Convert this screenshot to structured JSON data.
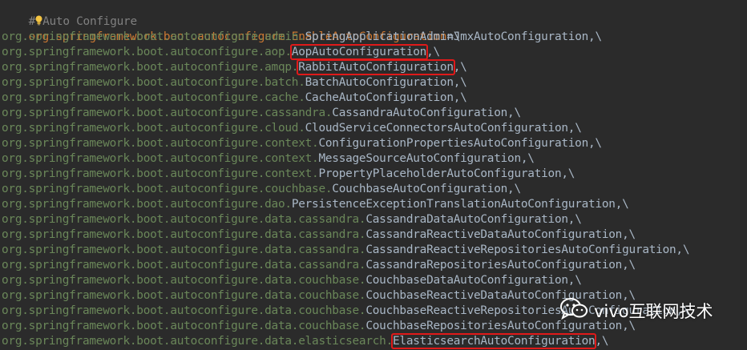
{
  "editor": {
    "header": {
      "hash": "#",
      "bulb_icon": "lightbulb-icon",
      "comment": "Auto Configure"
    },
    "first_line": {
      "key": "org.springframework.boot.autoconfigure.EnableAutoConfiguration",
      "suffix": "=\\"
    },
    "lines": [
      {
        "pkg": "org.springframework.boot.autoconfigure.admin.",
        "cls": "SpringApplicationAdminJmxAutoConfiguration",
        "tail": ",\\",
        "highlight": false
      },
      {
        "pkg": "org.springframework.boot.autoconfigure.aop.",
        "cls": "AopAutoConfiguration",
        "tail": ",\\",
        "highlight": true
      },
      {
        "pkg": "org.springframework.boot.autoconfigure.amqp.",
        "cls": "RabbitAutoConfiguration",
        "tail": ",\\",
        "highlight": true
      },
      {
        "pkg": "org.springframework.boot.autoconfigure.batch.",
        "cls": "BatchAutoConfiguration",
        "tail": ",\\",
        "highlight": false
      },
      {
        "pkg": "org.springframework.boot.autoconfigure.cache.",
        "cls": "CacheAutoConfiguration",
        "tail": ",\\",
        "highlight": false
      },
      {
        "pkg": "org.springframework.boot.autoconfigure.cassandra.",
        "cls": "CassandraAutoConfiguration",
        "tail": ",\\",
        "highlight": false
      },
      {
        "pkg": "org.springframework.boot.autoconfigure.cloud.",
        "cls": "CloudServiceConnectorsAutoConfiguration",
        "tail": ",\\",
        "highlight": false
      },
      {
        "pkg": "org.springframework.boot.autoconfigure.context.",
        "cls": "ConfigurationPropertiesAutoConfiguration",
        "tail": ",\\",
        "highlight": false
      },
      {
        "pkg": "org.springframework.boot.autoconfigure.context.",
        "cls": "MessageSourceAutoConfiguration",
        "tail": ",\\",
        "highlight": false
      },
      {
        "pkg": "org.springframework.boot.autoconfigure.context.",
        "cls": "PropertyPlaceholderAutoConfiguration",
        "tail": ",\\",
        "highlight": false
      },
      {
        "pkg": "org.springframework.boot.autoconfigure.couchbase.",
        "cls": "CouchbaseAutoConfiguration",
        "tail": ",\\",
        "highlight": false
      },
      {
        "pkg": "org.springframework.boot.autoconfigure.dao.",
        "cls": "PersistenceExceptionTranslationAutoConfiguration",
        "tail": ",\\",
        "highlight": false
      },
      {
        "pkg": "org.springframework.boot.autoconfigure.data.cassandra.",
        "cls": "CassandraDataAutoConfiguration",
        "tail": ",\\",
        "highlight": false
      },
      {
        "pkg": "org.springframework.boot.autoconfigure.data.cassandra.",
        "cls": "CassandraReactiveDataAutoConfiguration",
        "tail": ",\\",
        "highlight": false
      },
      {
        "pkg": "org.springframework.boot.autoconfigure.data.cassandra.",
        "cls": "CassandraReactiveRepositoriesAutoConfiguration",
        "tail": ",\\",
        "highlight": false
      },
      {
        "pkg": "org.springframework.boot.autoconfigure.data.cassandra.",
        "cls": "CassandraRepositoriesAutoConfiguration",
        "tail": ",\\",
        "highlight": false
      },
      {
        "pkg": "org.springframework.boot.autoconfigure.data.couchbase.",
        "cls": "CouchbaseDataAutoConfiguration",
        "tail": ",\\",
        "highlight": false
      },
      {
        "pkg": "org.springframework.boot.autoconfigure.data.couchbase.",
        "cls": "CouchbaseReactiveDataAutoConfiguration",
        "tail": ",\\",
        "highlight": false
      },
      {
        "pkg": "org.springframework.boot.autoconfigure.data.couchbase.",
        "cls": "CouchbaseReactiveRepositoriesAutoConfiguration",
        "tail": ",\\",
        "highlight": false
      },
      {
        "pkg": "org.springframework.boot.autoconfigure.data.couchbase.",
        "cls": "CouchbaseRepositoriesAutoConfiguration",
        "tail": ",\\",
        "highlight": false
      },
      {
        "pkg": "org.springframework.boot.autoconfigure.data.elasticsearch.",
        "cls": "ElasticsearchAutoConfiguration",
        "tail": ",\\",
        "highlight": true
      }
    ]
  },
  "watermark": {
    "icon": "wechat-icon",
    "text": "vivo互联网技术"
  },
  "colors": {
    "background": "#2b2b2b",
    "comment": "#808080",
    "key": "#cc7832",
    "package": "#6a8759",
    "class": "#a9b7c6",
    "highlight_box": "#e01a1a"
  }
}
